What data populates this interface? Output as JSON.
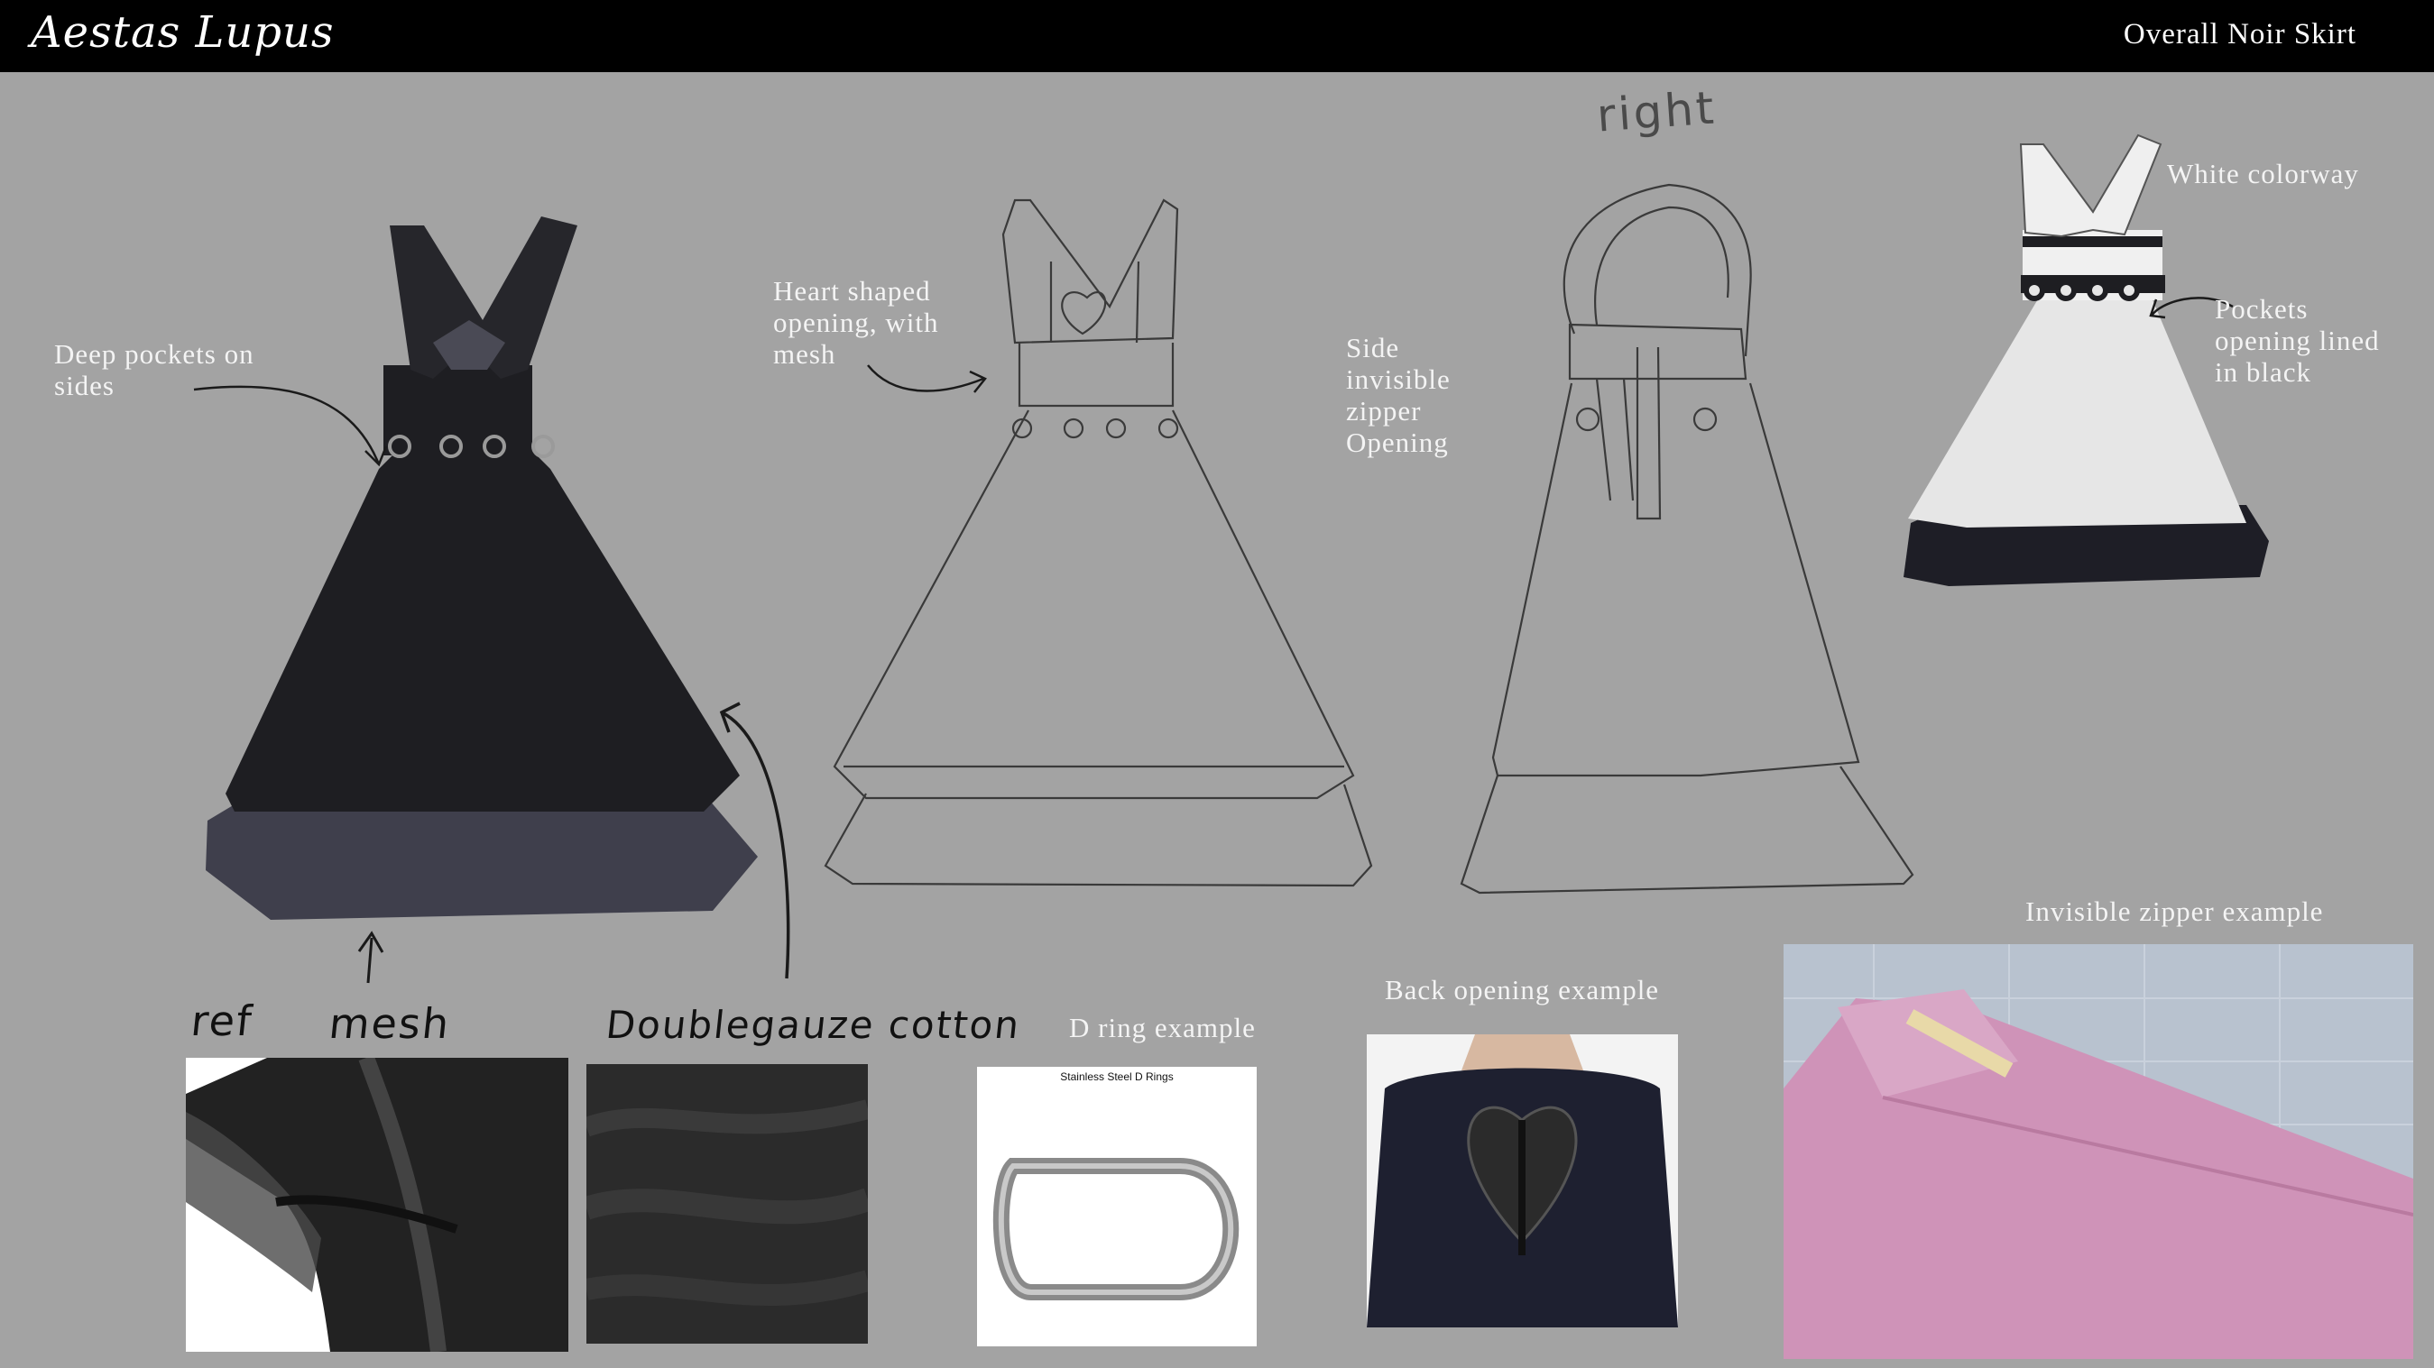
{
  "header": {
    "brand": "Aestas Lupus",
    "project": "Overall Noir Skirt"
  },
  "annotations": {
    "pockets": "Deep pockets on\nsides",
    "heart": "Heart shaped\nopening, with\nmesh",
    "zipper": "Side\ninvisible\nzipper\nOpening",
    "white_colorway": "White colorway",
    "pockets_lined": "Pockets\nopening lined\nin black",
    "invisible_zipper_example": "Invisible zipper example",
    "back_opening_example": "Back opening example",
    "d_ring_example": "D ring example"
  },
  "handwritten": {
    "right": "right",
    "ref": "ref",
    "mesh": "mesh",
    "doublegauze": "Doublegauze cotton"
  },
  "photos": {
    "d_ring_caption": "Stainless Steel D Rings"
  },
  "colors": {
    "background": "#a3a3a3",
    "header": "#000000",
    "dress_black": "#1e1e22",
    "dress_underlayer": "#3f3f4c",
    "white_dress": "#e6e6e6",
    "pink_fabric": "#cf93b8"
  }
}
